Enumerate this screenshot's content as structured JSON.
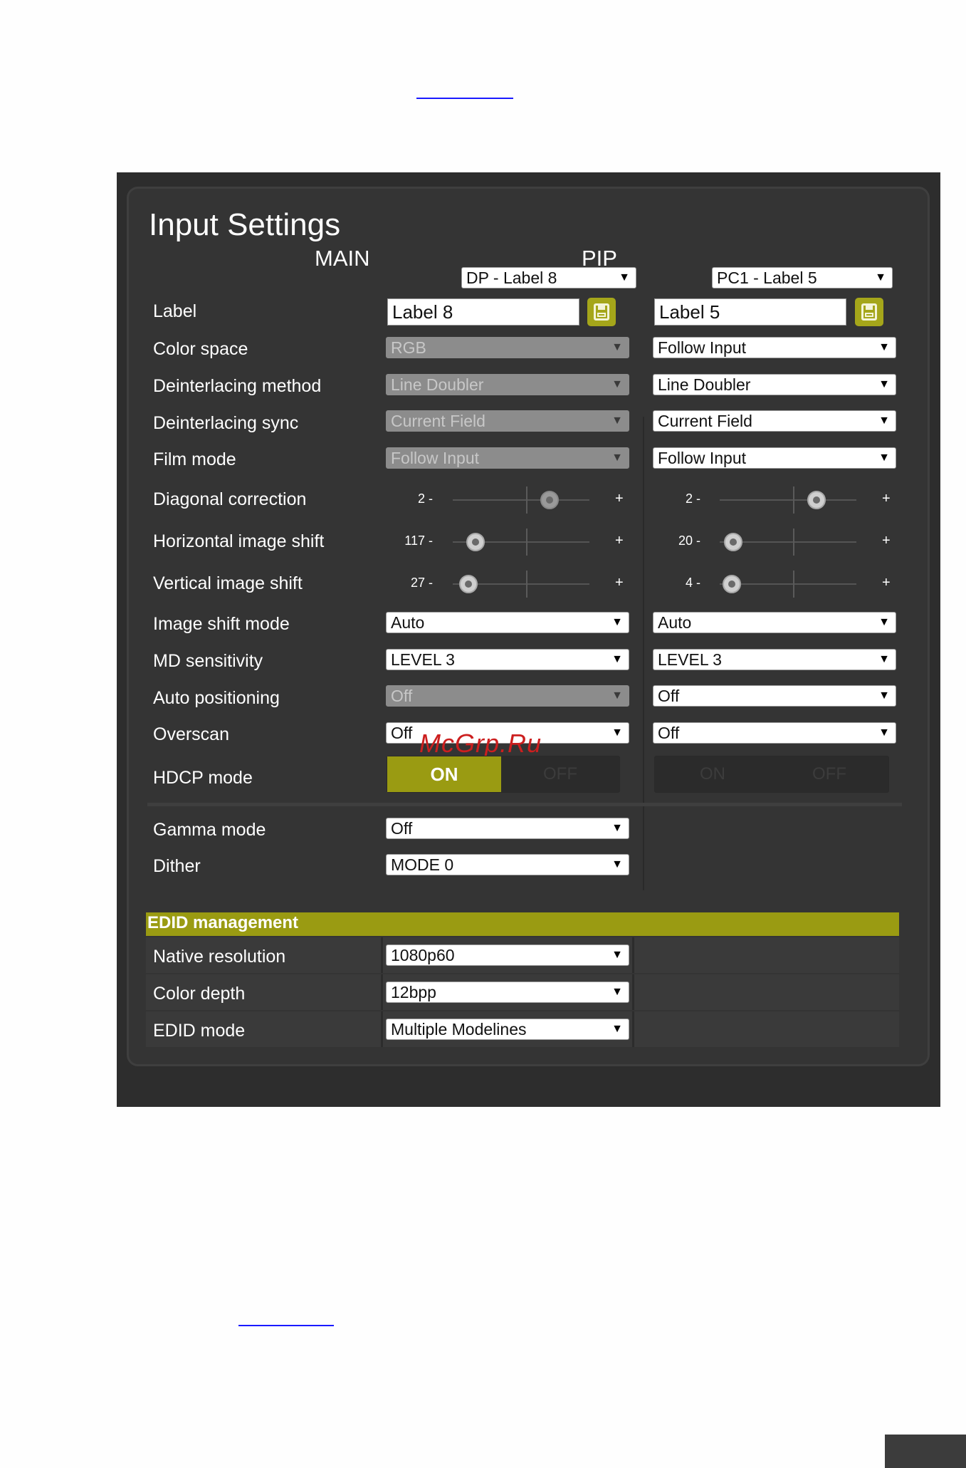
{
  "title": "Input Settings",
  "main": {
    "heading": "MAIN",
    "source": "DP - Label 8",
    "label_value": "Label 8"
  },
  "pip": {
    "heading": "PIP",
    "source": "PC1 - Label 5",
    "label_value": "Label 5"
  },
  "labels": {
    "label": "Label",
    "color_space": "Color space",
    "deint_method": "Deinterlacing method",
    "deint_sync": "Deinterlacing sync",
    "film_mode": "Film mode",
    "diag": "Diagonal correction",
    "hshift": "Horizontal image shift",
    "vshift": "Vertical image shift",
    "shift_mode": "Image shift mode",
    "md": "MD sensitivity",
    "auto_pos": "Auto positioning",
    "overscan": "Overscan",
    "hdcp": "HDCP mode",
    "gamma": "Gamma mode",
    "dither": "Dither"
  },
  "main_values": {
    "color_space": "RGB",
    "deint_method": "Line Doubler",
    "deint_sync": "Current Field",
    "film_mode": "Follow Input",
    "shift_mode": "Auto",
    "md": "LEVEL 3",
    "auto_pos": "Off",
    "overscan": "Off",
    "gamma": "Off",
    "dither": "MODE 0"
  },
  "pip_values": {
    "color_space": "Follow Input",
    "deint_method": "Line Doubler",
    "deint_sync": "Current Field",
    "film_mode": "Follow Input",
    "shift_mode": "Auto",
    "md": "LEVEL 3",
    "auto_pos": "Off",
    "overscan": "Off"
  },
  "sliders": {
    "main": {
      "diag": "2 -",
      "hshift": "117 -",
      "vshift": "27 -"
    },
    "pip": {
      "diag": "2 -",
      "hshift": "20 -",
      "vshift": "4 -"
    },
    "plus": "+"
  },
  "hdcp": {
    "on": "ON",
    "off": "OFF"
  },
  "edid": {
    "title": "EDID management",
    "native_res_label": "Native resolution",
    "native_res": "1080p60",
    "color_depth_label": "Color depth",
    "color_depth": "12bpp",
    "mode_label": "EDID mode",
    "mode": "Multiple Modelines"
  },
  "arrow": "▼",
  "watermark": "McGrp.Ru",
  "colors": {
    "accent": "#9a9b12",
    "panel": "#343434",
    "outer": "#2d2d2d"
  }
}
